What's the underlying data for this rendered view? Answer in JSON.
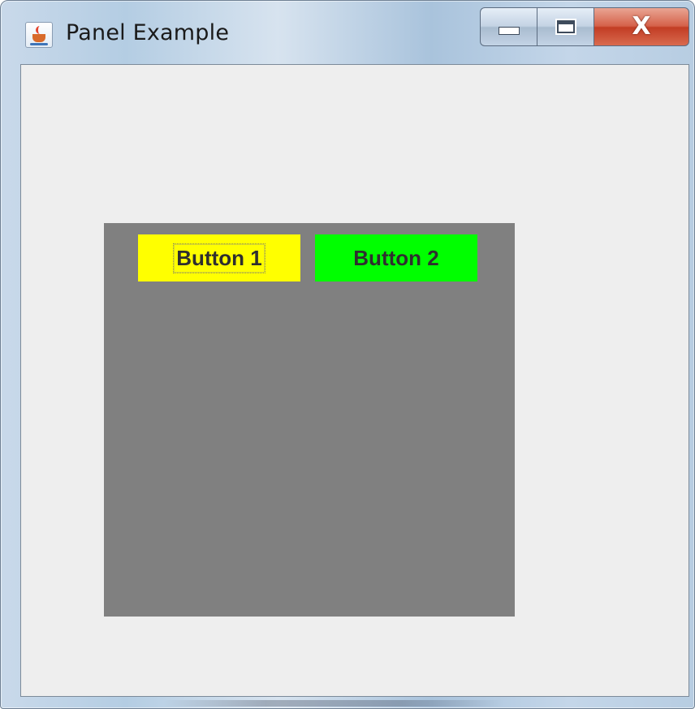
{
  "window": {
    "title": "Panel Example",
    "icon": "java-cup-icon"
  },
  "caption_buttons": {
    "minimize_icon": "minimize-icon",
    "maximize_icon": "maximize-icon",
    "close_label": "X"
  },
  "panel": {
    "background": "#808080",
    "buttons": [
      {
        "label": "Button 1",
        "color": "#ffff00",
        "focused": true
      },
      {
        "label": "Button 2",
        "color": "#00ff00",
        "focused": false
      }
    ]
  },
  "client_background": "#eeeeee"
}
